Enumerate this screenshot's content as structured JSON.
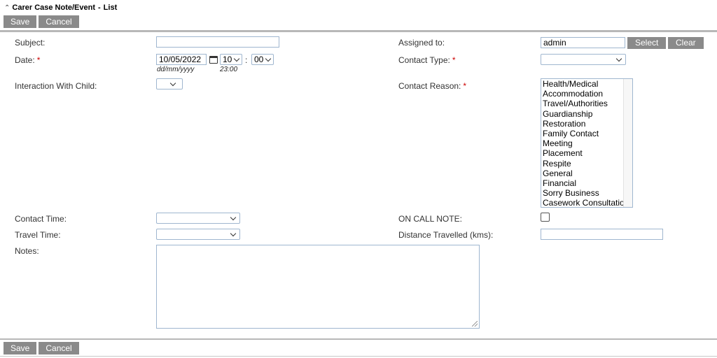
{
  "header": {
    "title": "Carer Case Note/Event",
    "separator": "-",
    "list_link": "List"
  },
  "toolbar": {
    "save_label": "Save",
    "cancel_label": "Cancel"
  },
  "form": {
    "subject": {
      "label": "Subject:",
      "value": ""
    },
    "assigned_to": {
      "label": "Assigned to:",
      "value": "admin",
      "select_label": "Select",
      "clear_label": "Clear"
    },
    "date": {
      "label": "Date:",
      "required": "*",
      "value": "10/05/2022",
      "hour": "10",
      "colon": ":",
      "minute": "00",
      "date_hint": "dd/mm/yyyy",
      "time_hint": "23:00"
    },
    "contact_type": {
      "label": "Contact Type:",
      "required": "*",
      "value": ""
    },
    "interaction_with_child": {
      "label": "Interaction With Child:",
      "value": ""
    },
    "contact_reason": {
      "label": "Contact Reason:",
      "required": "*",
      "options": [
        "Health/Medical",
        "Accommodation",
        "Travel/Authorities",
        "Guardianship",
        "Restoration",
        "Family Contact",
        "Meeting",
        "Placement",
        "Respite",
        "General",
        "Financial",
        "Sorry Business",
        "Casework Consultation"
      ]
    },
    "contact_time": {
      "label": "Contact Time:",
      "value": ""
    },
    "on_call_note": {
      "label": "ON CALL NOTE:",
      "checked": false
    },
    "travel_time": {
      "label": "Travel Time:",
      "value": ""
    },
    "distance_travelled": {
      "label": "Distance Travelled (kms):",
      "value": ""
    },
    "notes": {
      "label": "Notes:",
      "value": ""
    }
  },
  "icons": {
    "collapse": "chevron-double-up-icon",
    "calendar": "calendar-icon",
    "dropdown": "chevron-down-icon"
  }
}
